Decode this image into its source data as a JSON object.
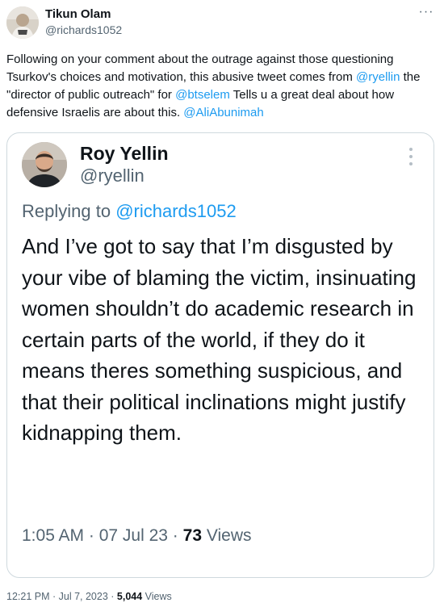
{
  "author": {
    "name": "Tikun Olam",
    "handle": "@richards1052"
  },
  "more_glyph": "···",
  "body": {
    "p1": "Following on your comment about the outrage against those questioning Tsurkov's choices and motivation, this abusive tweet comes from ",
    "mention_ryellin": "@ryellin",
    "p2": " the \"director of public outreach\" for ",
    "mention_btselem": "@btselem",
    "p3": " Tells u a great deal about how defensive Israelis are about this. ",
    "mention_ali": "@AliAbunimah"
  },
  "quoted": {
    "name": "Roy Yellin",
    "handle": "@ryellin",
    "replying_prefix": "Replying to ",
    "replying_handle": "@richards1052",
    "text": "And I’ve got to say that I’m disgusted by your  vibe of blaming the victim, insinuating  women shouldn’t do academic research in certain parts of the world,  if they do it means  theres something suspicious, and  that their political inclinations might justify kidnapping them.",
    "time": "1:05 AM",
    "date": "07 Jul 23",
    "views_count": "73",
    "views_label": "Views"
  },
  "footer": {
    "time": "12:21 PM",
    "date": "Jul 7, 2023",
    "views_count": "5,044",
    "views_label": "Views"
  },
  "separator": " · ",
  "colors": {
    "link": "#1d9bf0",
    "secondary_text": "#536471",
    "primary_text": "#0f1419",
    "border": "#cfd9de"
  }
}
